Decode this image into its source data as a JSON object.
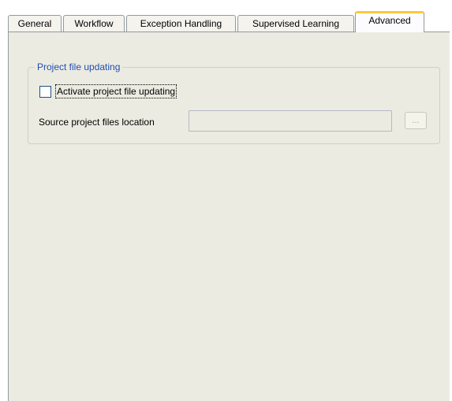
{
  "tabs": [
    {
      "label": "General",
      "active": false
    },
    {
      "label": "Workflow",
      "active": false
    },
    {
      "label": "Exception Handling",
      "active": false
    },
    {
      "label": "Supervised Learning",
      "active": false
    },
    {
      "label": "Advanced",
      "active": true
    }
  ],
  "group": {
    "title": "Project file updating",
    "activate_checkbox": {
      "label": "Activate project file updating",
      "checked": false
    },
    "source_location": {
      "label": "Source project files location",
      "value": "",
      "enabled": false
    },
    "browse_button": {
      "label": "...",
      "enabled": false
    }
  },
  "colors": {
    "panel_background": "#ecebe1",
    "group_title": "#1e4eb5",
    "active_tab_highlight": "#ffc83c"
  }
}
